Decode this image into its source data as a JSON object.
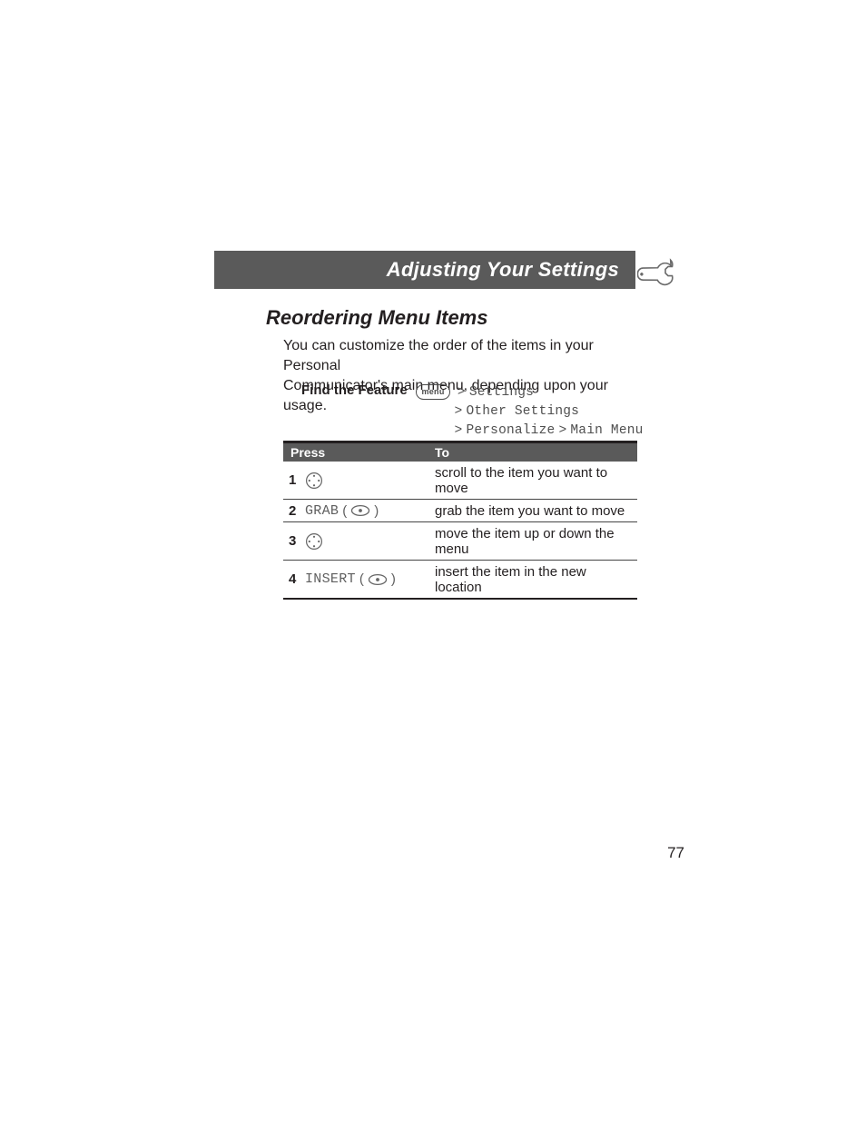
{
  "header": {
    "title": "Adjusting Your Settings",
    "icon": "wrench-icon"
  },
  "section": {
    "heading": "Reordering Menu Items",
    "intro_l1": "You can customize the order of the items in your Personal",
    "intro_l2": "Communicator's main menu, depending upon your usage."
  },
  "find": {
    "label": "Find the Feature",
    "menu_badge": "menu",
    "path_l1_prefix": ">",
    "path_l1": "Settings",
    "path_l2_prefix": ">",
    "path_l2": "Other Settings",
    "path_l3_prefix": ">",
    "path_l3a": "Personalize",
    "path_l3_mid": ">",
    "path_l3b": "Main Menu"
  },
  "table": {
    "head_press": "Press",
    "head_to": "To",
    "rows": [
      {
        "num": "1",
        "press_type": "nav",
        "press_label": "",
        "to": "scroll to the item you want to move"
      },
      {
        "num": "2",
        "press_type": "softsel",
        "press_label": "GRAB",
        "to": "grab the item you want to move"
      },
      {
        "num": "3",
        "press_type": "nav",
        "press_label": "",
        "to": "move the item up or down the menu"
      },
      {
        "num": "4",
        "press_type": "softsel",
        "press_label": "INSERT",
        "to": "insert the item in the new location"
      }
    ]
  },
  "page_number": "77"
}
